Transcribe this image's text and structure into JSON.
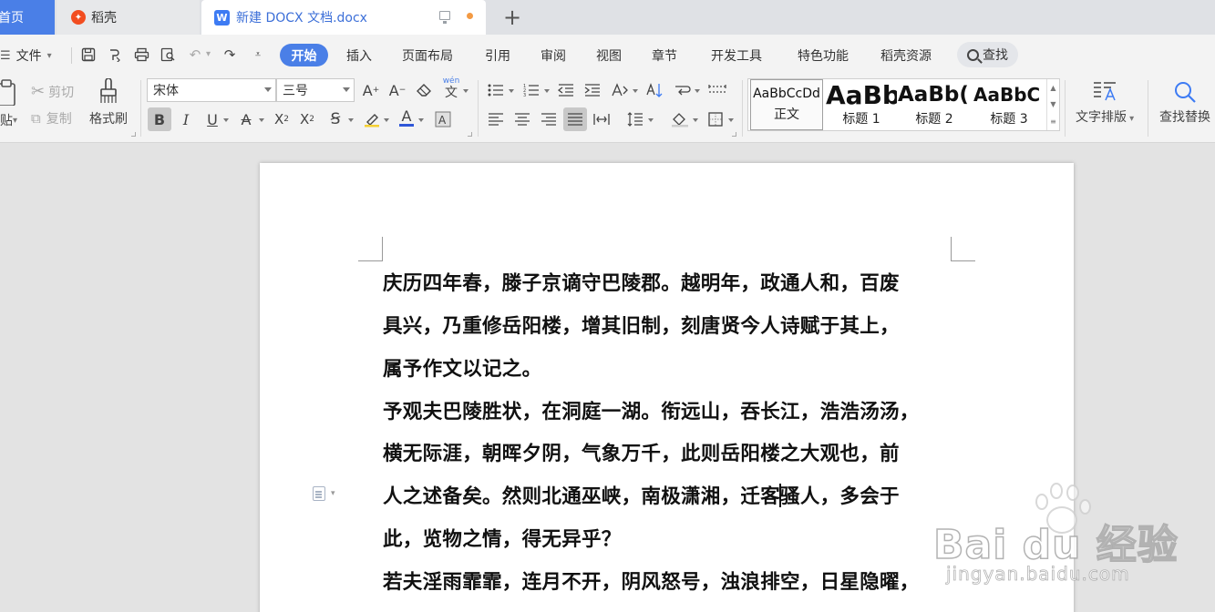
{
  "tabs": {
    "home": "首页",
    "daoke": "稻壳",
    "document": "新建 DOCX 文档.docx",
    "new_tab": "+"
  },
  "menu": {
    "file": "文件",
    "start": "开始",
    "items": [
      "插入",
      "页面布局",
      "引用",
      "审阅",
      "视图",
      "章节",
      "开发工具",
      "特色功能",
      "稻壳资源"
    ],
    "find": "查找"
  },
  "ribbon": {
    "paste": "贴",
    "cut": "剪切",
    "copy": "复制",
    "format_painter": "格式刷",
    "font_name": "宋体",
    "font_size": "三号",
    "styles": [
      {
        "sample": "AaBbCcDd",
        "name": "正文"
      },
      {
        "sample": "AaBb",
        "name": "标题 1"
      },
      {
        "sample": "AaBb(",
        "name": "标题 2"
      },
      {
        "sample": "AaBbC",
        "name": "标题 3"
      }
    ],
    "text_layout": "文字排版",
    "find_replace": "查找替换"
  },
  "document": {
    "lines": [
      "庆历四年春，滕子京谪守巴陵郡。越明年，政通人和，百废",
      "具兴，乃重修岳阳楼，增其旧制，刻唐贤今人诗赋于其上，",
      "属予作文以记之。",
      "予观夫巴陵胜状，在洞庭一湖。衔远山，吞长江，浩浩汤汤，",
      "横无际涯，朝晖夕阴，气象万千，此则岳阳楼之大观也，前",
      "人之述备矣。然则北通巫峡，南极潇湘，迁客",
      "骚人，多会于",
      "此，览物之情，得无异乎？",
      "若夫淫雨霏霏，连月不开，阴风怒号，浊浪排空，日星隐曜，"
    ]
  },
  "watermark": {
    "brand": "Bai du 经验",
    "url": "jingyan.baidu.com"
  },
  "colors": {
    "accent": "#4a7fe7",
    "doc_tab_text": "#3c6fd8",
    "daoke_logo": "#f24d20",
    "unsaved_dot": "#f39a43"
  }
}
